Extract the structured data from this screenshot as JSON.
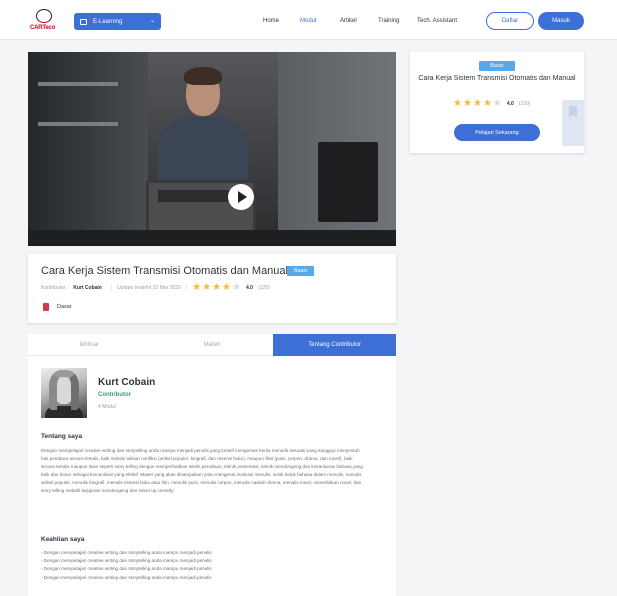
{
  "header": {
    "logo_text": "CARTeco",
    "category_label": "E-Learning",
    "nav": [
      "Home",
      "Modul",
      "Artikel",
      "Training",
      "Tech. Assistant"
    ],
    "active_nav": "Modul",
    "register_label": "Daftar",
    "login_label": "Masuk"
  },
  "course": {
    "title": "Cara Kerja Sistem Transmisi Otomatis dan Manual",
    "level_badge": "Basic",
    "contributor_label": "Kontributor :",
    "contributor_name": "Kurt Cobain",
    "updated": "Update terakhir 22 Mar 2020",
    "rating": "4.0",
    "rating_count": "(120)",
    "stars_filled": 4,
    "stars_total": 5,
    "level": "Dasar"
  },
  "tabs": [
    "Ikhtisar",
    "Materi",
    "Tentang Contributor"
  ],
  "active_tab": "Tentang Contributor",
  "contributor": {
    "name": "Kurt Cobain",
    "role": "Contributor",
    "modules": "4 Modul",
    "about_heading": "Tentang saya",
    "about_text": "Dengan mempelajari creative writing dan storytelling anda mampu menjadi penulis yang kreatif mengemas berita menarik sesuatu yang sanggup menyentuh hati pembaca secara tertulis, baik melalui tulisan nonfiksi (artikel populer, biografi, dan resensi buku), maupun fiksi (puisi, cerpen, drama, dan novel), baik secara tertulis maupun lisan seperti story telling dengan memperhatikan teknik penulisan, teknik presentasi, teknik mendongeng dan kesantunan bahasa yang baik dan benar sebagai komunikasi yang efektif. Materi yang akan disampaikan yaitu mengenai motivasi menulis, seluk beluk bahasa dalam menulis, menulis artikel populer, menulis biografi, menulis resensi buku atau film, menulis puisi, menulis cerpen, menulis naskah drama, menulis novel, menerbitkan novel, dan story telling melatih kejujuran mendongeng dan stand up comedy.",
    "skills_heading": "Keahlian saya",
    "skills": [
      "- Dengan mempelajari creative writing dan storytelling anda mampu menjadi penulis",
      "- Dengan mempelajari creative writing dan storytelling anda mampu menjadi penulis",
      "- Dengan mempelajari creative writing dan storytelling anda mampu menjadi penulis",
      "- Dengan mempelajari creative writing dan storytelling anda mampu menjadi penulis"
    ]
  },
  "side_card": {
    "badge": "Basic",
    "title": "Cara Kerja Sistem Transmisi Otomatis dan Manual",
    "rating": "4.0",
    "rating_count": "(120)",
    "cta": "Pelajari Sekarang"
  },
  "colors": {
    "accent": "#3d6fd6",
    "badge": "#56a9ea",
    "star": "#f2bc3b",
    "contributor_role": "#2ba471"
  }
}
